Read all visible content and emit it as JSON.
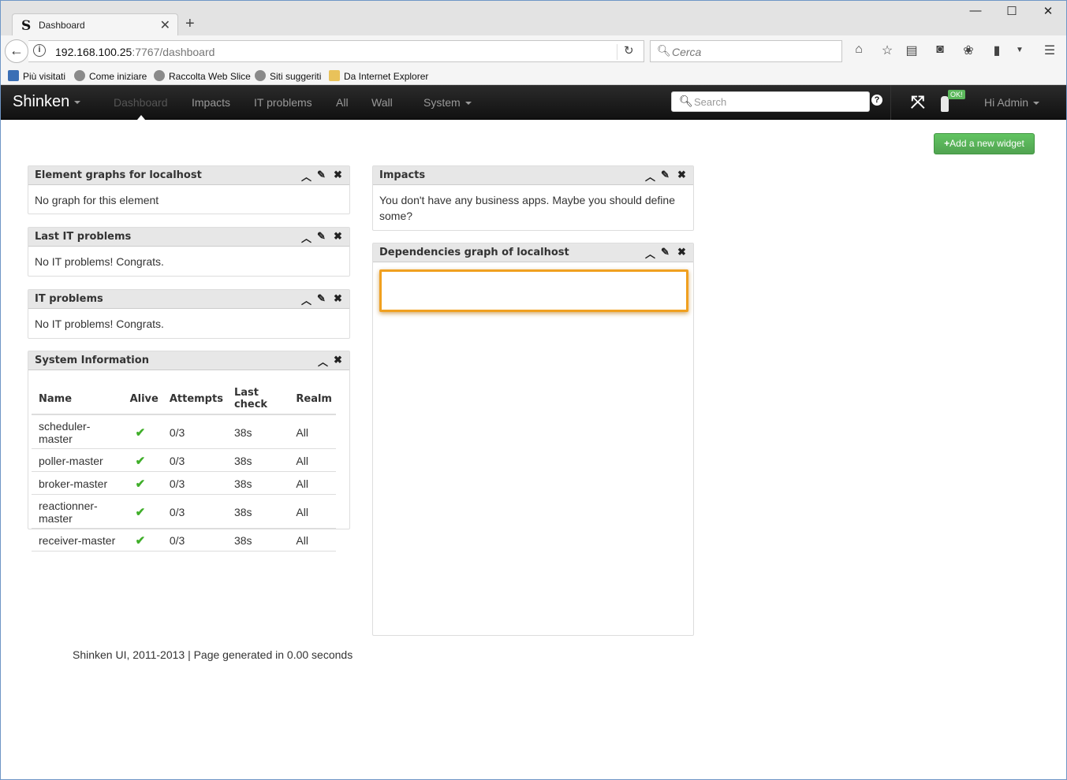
{
  "browser": {
    "tab_title": "Dashboard",
    "url_host": "192.168.100.25",
    "url_path": ":7767/dashboard",
    "search_placeholder": "Cerca",
    "bookmarks": [
      "Più visitati",
      "Come iniziare",
      "Raccolta Web Slice",
      "Siti suggeriti",
      "Da Internet Explorer"
    ]
  },
  "app": {
    "brand": "Shinken",
    "nav": [
      "Dashboard",
      "Impacts",
      "IT problems",
      "All",
      "Wall",
      "System"
    ],
    "search_placeholder": "Search",
    "help": "?",
    "status_badge": "OK!",
    "user_menu": "Hi Admin",
    "add_widget": "Add a new widget",
    "colors": {
      "add_widget": "#5cb85c",
      "graph_border": "#f0a020",
      "check": "#3fae29"
    }
  },
  "widgets": {
    "element_graphs": {
      "title": "Element graphs for localhost",
      "text": "No graph for this element"
    },
    "last_it_problems": {
      "title": "Last IT problems",
      "text": "No IT problems! Congrats."
    },
    "it_problems": {
      "title": "IT problems",
      "text": "No IT problems! Congrats."
    },
    "system_info": {
      "title": "System Information",
      "columns": [
        "Name",
        "Alive",
        "Attempts",
        "Last check",
        "Realm"
      ],
      "rows": [
        {
          "name": "scheduler-master",
          "attempts": "0/3",
          "last_check": "38s",
          "realm": "All"
        },
        {
          "name": "poller-master",
          "attempts": "0/3",
          "last_check": "38s",
          "realm": "All"
        },
        {
          "name": "broker-master",
          "attempts": "0/3",
          "last_check": "38s",
          "realm": "All"
        },
        {
          "name": "reactionner-master",
          "attempts": "0/3",
          "last_check": "38s",
          "realm": "All"
        },
        {
          "name": "receiver-master",
          "attempts": "0/3",
          "last_check": "38s",
          "realm": "All"
        }
      ]
    },
    "impacts": {
      "title": "Impacts",
      "text": "You don't have any business apps. Maybe you should define some?"
    },
    "dependencies": {
      "title": "Dependencies graph of localhost"
    }
  },
  "footer": "Shinken UI, 2011-2013 | Page generated in 0.00 seconds"
}
